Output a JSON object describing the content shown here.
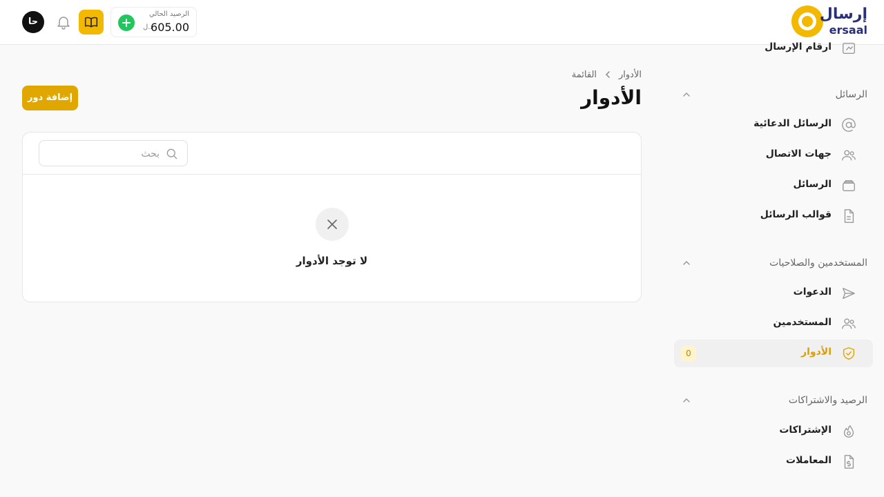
{
  "brand": {
    "logo_ar": "إرسال",
    "logo_en": "ersaal",
    "accent_color": "#f3b800"
  },
  "header": {
    "avatar_initials": "حا",
    "balance_label": "الرصيد الحالي",
    "balance_value": "605.00",
    "currency": "د.ل",
    "icons": {
      "notifications": "bell-icon",
      "docs": "book-icon",
      "topup": "plus-icon"
    }
  },
  "sidebar": {
    "partial_item": {
      "label": "ارقام الإرسال",
      "icon": "send-numbers-icon"
    },
    "sections": [
      {
        "title": "الرسائل",
        "items": [
          {
            "label": "الرسائل الدعائية",
            "icon": "at-sign-icon"
          },
          {
            "label": "جهات الاتصال",
            "icon": "users-icon"
          },
          {
            "label": "الرسائل",
            "icon": "messages-icon"
          },
          {
            "label": "قوالب الرسائل",
            "icon": "file-template-icon"
          }
        ]
      },
      {
        "title": "المستخدمين والصلاحيات",
        "items": [
          {
            "label": "الدعوات",
            "icon": "send-icon"
          },
          {
            "label": "المستخدمين",
            "icon": "users-icon"
          },
          {
            "label": "الأدوار",
            "icon": "shield-check-icon",
            "active": true,
            "badge": "0"
          }
        ]
      },
      {
        "title": "الرصيد والاشتراكات",
        "items": [
          {
            "label": "الإشتراكات",
            "icon": "flame-icon"
          },
          {
            "label": "المعاملات",
            "icon": "file-dollar-icon"
          }
        ]
      }
    ]
  },
  "main": {
    "breadcrumb": [
      "الأدوار",
      "القائمة"
    ],
    "title": "الأدوار",
    "add_button": "إضافة دور",
    "search_placeholder": "بحث",
    "empty_message": "لا توجد الأدوار"
  }
}
